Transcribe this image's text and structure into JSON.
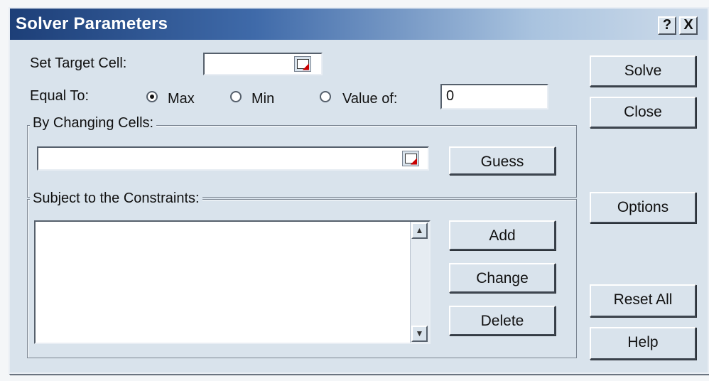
{
  "window": {
    "title": "Solver Parameters"
  },
  "titlebar": {
    "help": "?",
    "close": "X"
  },
  "target": {
    "label": "Set Target Cell:",
    "value": ""
  },
  "equal_to": {
    "label": "Equal To:",
    "options": [
      {
        "label": "Max",
        "selected": true
      },
      {
        "label": "Min",
        "selected": false
      },
      {
        "label": "Value of:",
        "selected": false
      }
    ],
    "value_of": "0"
  },
  "changing": {
    "legend": "By Changing Cells:",
    "value": "",
    "guess": "Guess"
  },
  "constraints": {
    "legend": "Subject to the Constraints:",
    "items": [],
    "add": "Add",
    "change": "Change",
    "delete": "Delete"
  },
  "side_buttons": {
    "solve": "Solve",
    "close": "Close",
    "options": "Options",
    "reset": "Reset All",
    "help": "Help"
  }
}
